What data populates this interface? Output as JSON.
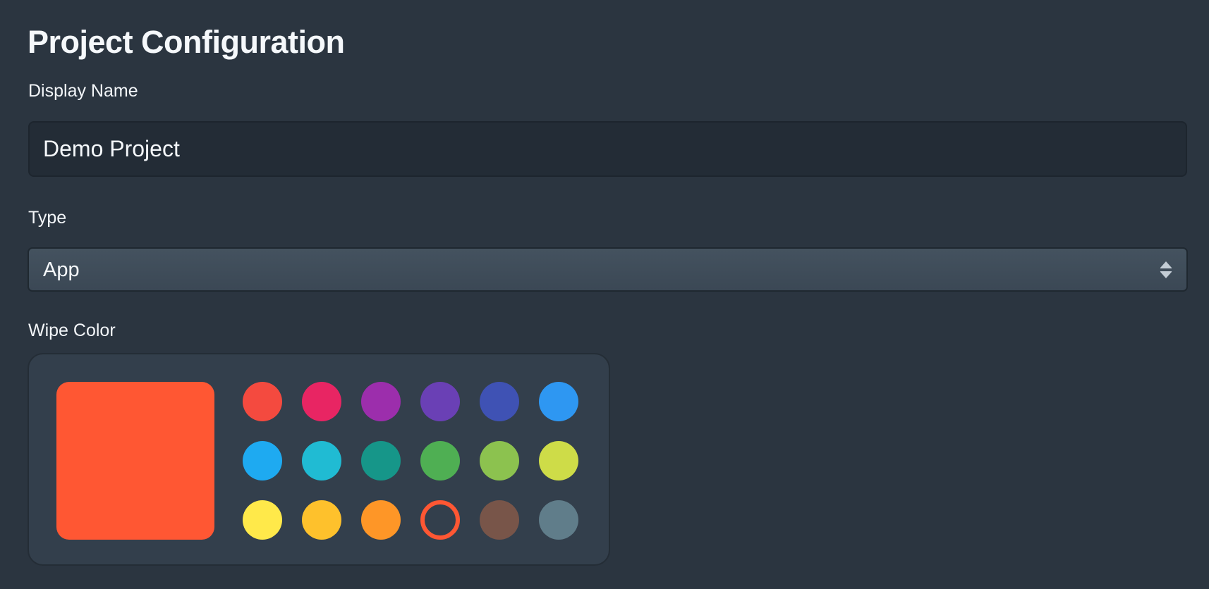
{
  "page": {
    "title": "Project Configuration"
  },
  "display_name": {
    "label": "Display Name",
    "value": "Demo Project"
  },
  "type": {
    "label": "Type",
    "selected": "App"
  },
  "wipe_color": {
    "label": "Wipe Color",
    "selected_color": "#ff5733",
    "selected_index": 15,
    "swatches": [
      {
        "name": "red",
        "color": "#f44a3f"
      },
      {
        "name": "pink",
        "color": "#e82563"
      },
      {
        "name": "purple",
        "color": "#9c2eac"
      },
      {
        "name": "deep-purple",
        "color": "#6a40b5"
      },
      {
        "name": "indigo",
        "color": "#3f52b4"
      },
      {
        "name": "blue",
        "color": "#2e97f2"
      },
      {
        "name": "light-blue",
        "color": "#1eaaf1"
      },
      {
        "name": "cyan",
        "color": "#20bbd3"
      },
      {
        "name": "teal",
        "color": "#169689"
      },
      {
        "name": "green",
        "color": "#4faf53"
      },
      {
        "name": "light-green",
        "color": "#8cc24f"
      },
      {
        "name": "lime",
        "color": "#cedc48"
      },
      {
        "name": "yellow",
        "color": "#ffe94a"
      },
      {
        "name": "amber",
        "color": "#fec12c"
      },
      {
        "name": "orange",
        "color": "#fe9627"
      },
      {
        "name": "deep-orange",
        "color": "#ff5733"
      },
      {
        "name": "brown",
        "color": "#785549"
      },
      {
        "name": "blue-grey",
        "color": "#607d8a"
      }
    ]
  }
}
